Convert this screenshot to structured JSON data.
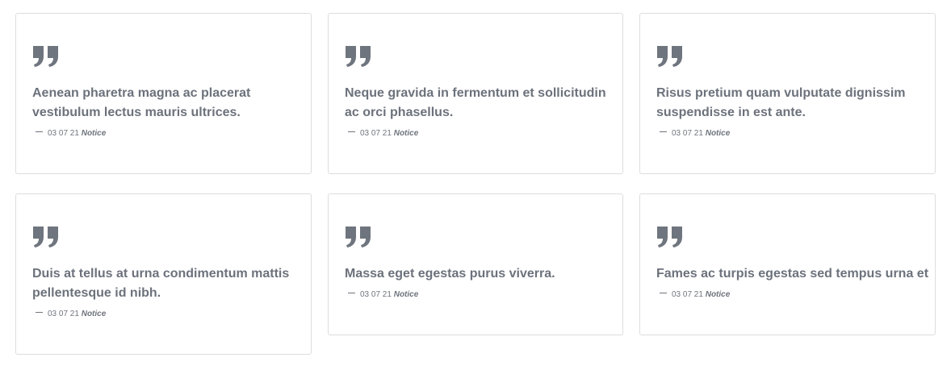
{
  "cards": [
    {
      "title_lines": [
        "Aenean pharetra magna ac placerat",
        "vestibulum lectus mauris ultrices."
      ],
      "date": "03 07 21",
      "category": "Notice"
    },
    {
      "title_lines": [
        "Neque gravida in fermentum et sollicitudin",
        "ac orci phasellus."
      ],
      "date": "03 07 21",
      "category": "Notice"
    },
    {
      "title_lines": [
        "Risus pretium quam vulputate dignissim",
        "suspendisse in est ante."
      ],
      "date": "03 07 21",
      "category": "Notice"
    },
    {
      "title_lines": [
        "Duis at tellus at urna condimentum mattis",
        "pellentesque id nibh."
      ],
      "date": "03 07 21",
      "category": "Notice"
    },
    {
      "title_lines": [
        "Massa eget egestas purus viverra."
      ],
      "date": "03 07 21",
      "category": "Notice"
    },
    {
      "title_lines": [
        "Fames ac turpis egestas sed tempus urna et"
      ],
      "date": "03 07 21",
      "category": "Notice"
    }
  ],
  "colors": {
    "text": "#6c727c",
    "border": "#dcdde0",
    "icon": "#6f757e"
  },
  "icon": "closing-quote-icon"
}
